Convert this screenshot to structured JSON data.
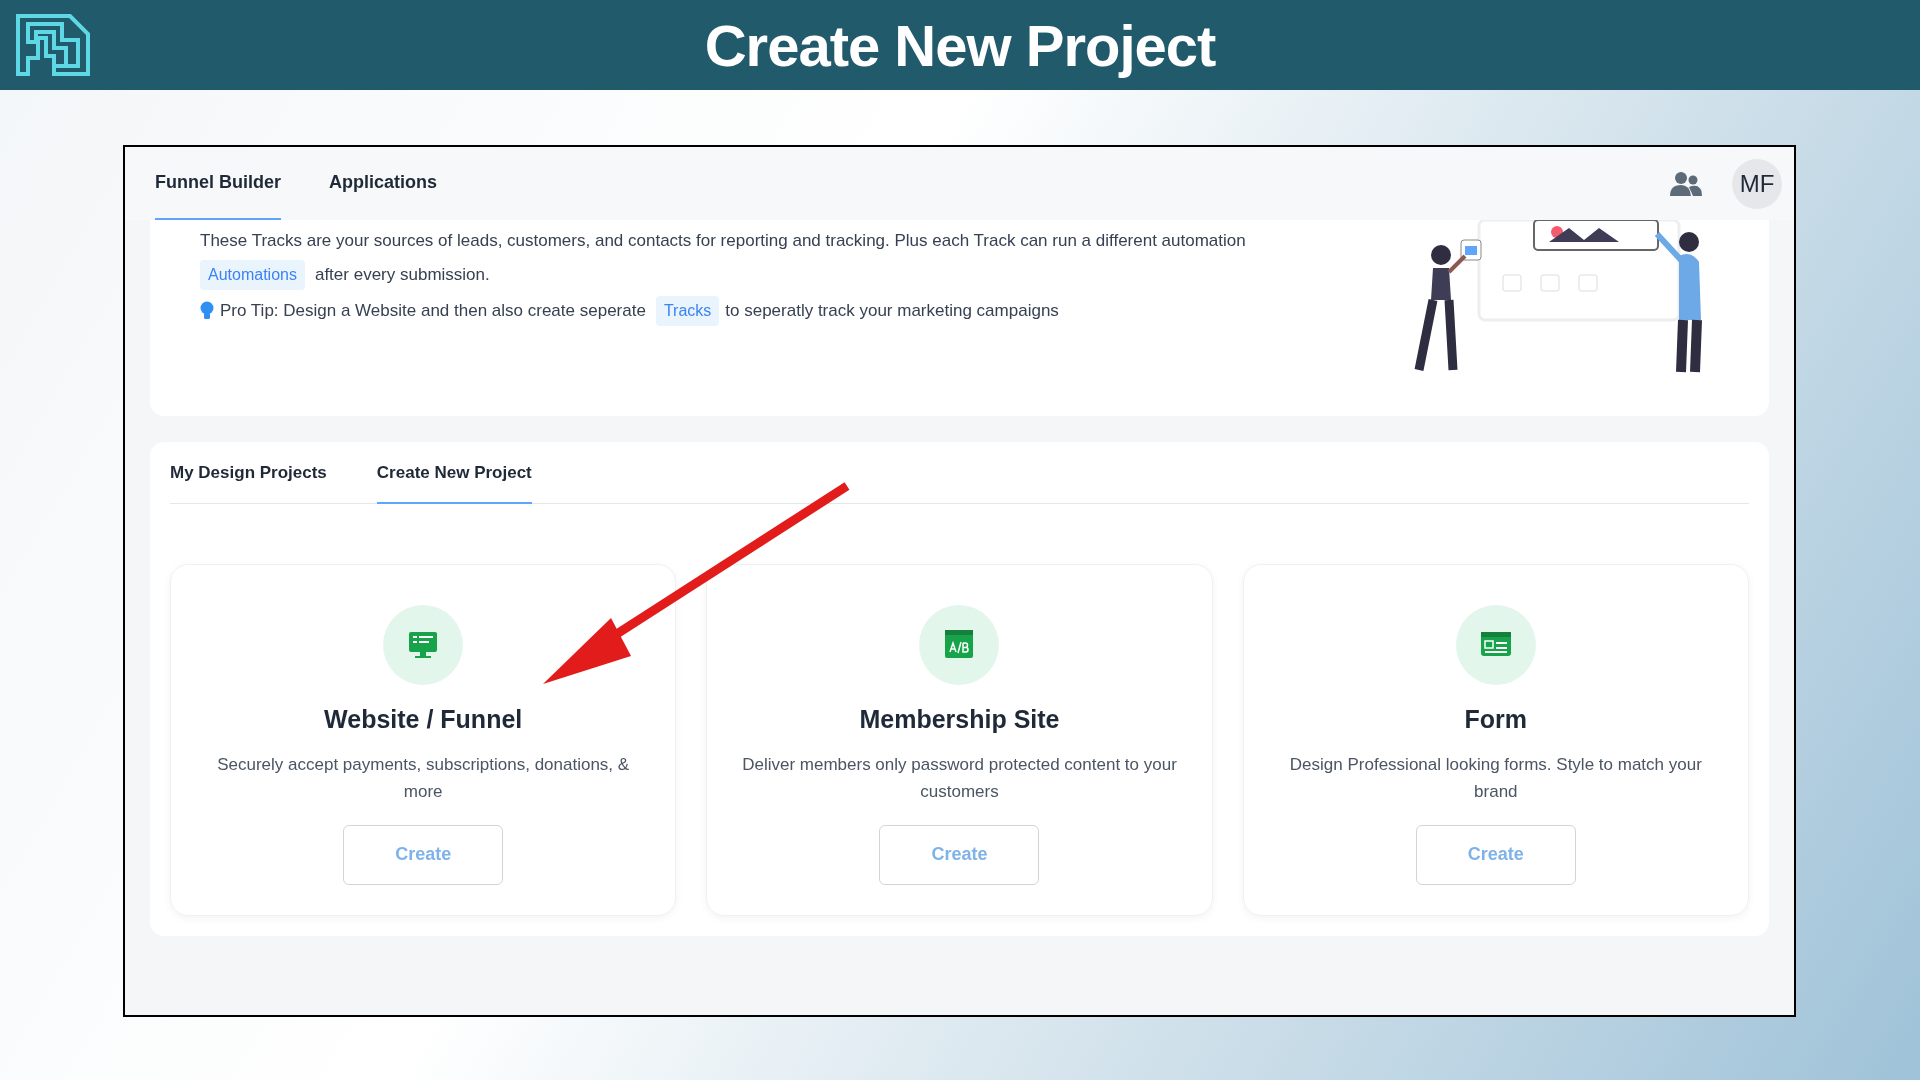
{
  "banner": {
    "title": "Create New Project"
  },
  "nav": {
    "tabs": [
      {
        "label": "Funnel Builder",
        "selected": true
      },
      {
        "label": "Applications",
        "selected": false
      }
    ],
    "avatar": "MF"
  },
  "intro": {
    "line_1": "These Tracks are your sources of leads, customers, and contacts for reporting and tracking. Plus each Track can run a different automation",
    "line_2": {
      "tag": "Automations",
      "text": "after every submission."
    },
    "tip": {
      "before": "Pro Tip: Design a Website and then also create seperate",
      "tag": "Tracks",
      "after": "to seperatly track your marketing campaigns"
    }
  },
  "project_tabs": [
    {
      "label": "My Design Projects",
      "selected": false
    },
    {
      "label": "Create New Project",
      "selected": true
    }
  ],
  "cards": [
    {
      "kind": "website",
      "title": "Website / Funnel",
      "description": "Securely accept payments, subscriptions, donations, & more",
      "button": "Create"
    },
    {
      "kind": "membership",
      "title": "Membership Site",
      "description": "Deliver members only password protected content to your customers",
      "button": "Create"
    },
    {
      "kind": "form",
      "title": "Form",
      "description": "Design Professional looking forms. Style to match your brand",
      "button": "Create"
    }
  ]
}
